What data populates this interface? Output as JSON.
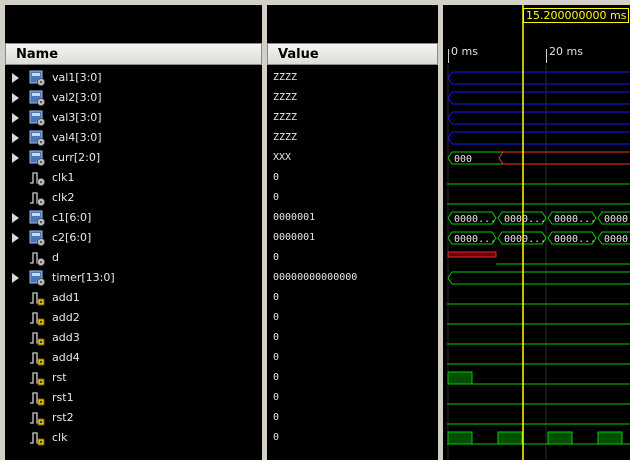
{
  "columns": {
    "name": "Name",
    "value": "Value"
  },
  "timeline": {
    "ticks": [
      {
        "label": "0 ms"
      },
      {
        "label": "20 ms"
      }
    ],
    "cursor_label": "15.200000000 ms"
  },
  "colors": {
    "bus_z": "#1515ff",
    "bus_x": "#ff2a2a",
    "digital": "#00d000",
    "cursor": "#ffff00"
  },
  "signals": [
    {
      "name": "val1[3:0]",
      "value": "ZZZZ",
      "kind": "bus",
      "expandable": true,
      "icon": "bus-signal-icon"
    },
    {
      "name": "val2[3:0]",
      "value": "ZZZZ",
      "kind": "bus",
      "expandable": true,
      "icon": "bus-signal-icon"
    },
    {
      "name": "val3[3:0]",
      "value": "ZZZZ",
      "kind": "bus",
      "expandable": true,
      "icon": "bus-signal-icon"
    },
    {
      "name": "val4[3:0]",
      "value": "ZZZZ",
      "kind": "bus",
      "expandable": true,
      "icon": "bus-signal-icon"
    },
    {
      "name": "curr[2:0]",
      "value": "XXX",
      "kind": "bus",
      "expandable": true,
      "icon": "bus-signal-icon",
      "wave_text": [
        "000"
      ]
    },
    {
      "name": "clk1",
      "value": "0",
      "kind": "bit",
      "expandable": false,
      "icon": "bit-signal-icon"
    },
    {
      "name": "clk2",
      "value": "0",
      "kind": "bit",
      "expandable": false,
      "icon": "bit-signal-icon"
    },
    {
      "name": "c1[6:0]",
      "value": "0000001",
      "kind": "bus",
      "expandable": true,
      "icon": "bus-signal-icon",
      "wave_text": [
        "0000...",
        "0000...",
        "0000...",
        "0000"
      ]
    },
    {
      "name": "c2[6:0]",
      "value": "0000001",
      "kind": "bus",
      "expandable": true,
      "icon": "bus-signal-icon",
      "wave_text": [
        "0000...",
        "0000...",
        "0000...",
        "0000"
      ]
    },
    {
      "name": "d",
      "value": "0",
      "kind": "bit",
      "expandable": false,
      "icon": "bit-signal-icon"
    },
    {
      "name": "timer[13:0]",
      "value": "00000000000000",
      "kind": "bus",
      "expandable": true,
      "icon": "bus-signal-icon"
    },
    {
      "name": "add1",
      "value": "0",
      "kind": "bit",
      "expandable": false,
      "icon": "locked-bit-signal-icon"
    },
    {
      "name": "add2",
      "value": "0",
      "kind": "bit",
      "expandable": false,
      "icon": "locked-bit-signal-icon"
    },
    {
      "name": "add3",
      "value": "0",
      "kind": "bit",
      "expandable": false,
      "icon": "locked-bit-signal-icon"
    },
    {
      "name": "add4",
      "value": "0",
      "kind": "bit",
      "expandable": false,
      "icon": "locked-bit-signal-icon"
    },
    {
      "name": "rst",
      "value": "0",
      "kind": "bit",
      "expandable": false,
      "icon": "locked-bit-signal-icon"
    },
    {
      "name": "rst1",
      "value": "0",
      "kind": "bit",
      "expandable": false,
      "icon": "locked-bit-signal-icon"
    },
    {
      "name": "rst2",
      "value": "0",
      "kind": "bit",
      "expandable": false,
      "icon": "locked-bit-signal-icon"
    },
    {
      "name": "clk",
      "value": "0",
      "kind": "bit",
      "expandable": false,
      "icon": "locked-bit-signal-icon"
    }
  ]
}
